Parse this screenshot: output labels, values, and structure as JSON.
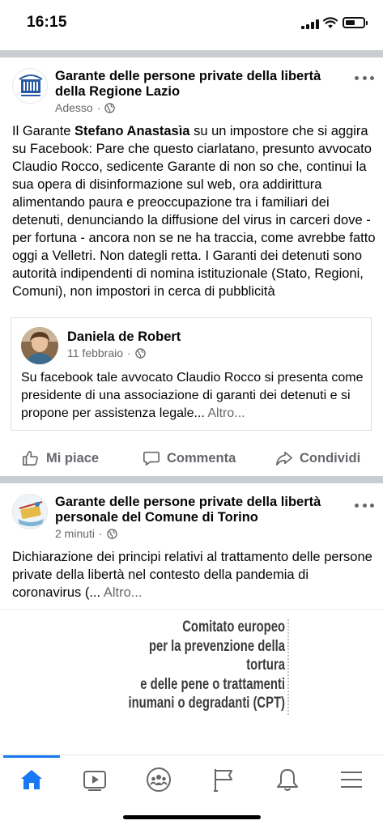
{
  "status_bar": {
    "time": "16:15",
    "battery_level": 0.55,
    "icons": [
      "signal-icon",
      "wifi-icon",
      "battery-icon"
    ]
  },
  "posts": [
    {
      "author": "Garante delle persone private della libertà della Regione Lazio",
      "time": "Adesso",
      "audience_icon": "globe-icon",
      "text_parts": [
        "Il Garante ",
        "Stefano Anastasìa",
        " su un impostore che si aggira su Facebook: Pare che questo ciarlatano, presunto avvocato Claudio Rocco, sedicente Garante di non so che, continui la sua opera di disinformazione sul web, ora addirittura alimentando paura e preoccupazione tra i familiari dei detenuti, denunciando la diffusione del virus in carceri dove - per fortuna - ancora non se ne ha traccia, come avrebbe fatto oggi a Velletri. Non dategli retta. I Garanti dei detenuti sono autorità indipendenti di nomina istituzionale (Stato, Regioni, Comuni), non impostori in cerca di pubblicità"
      ],
      "shared": {
        "author": "Daniela de Robert",
        "time": "11 febbraio",
        "text": "Su facebook tale avvocato Claudio Rocco si presenta come presidente di una associazione di garanti dei detenuti e si propone per assistenza legale...",
        "see_more": "Altro..."
      },
      "actions": {
        "like": "Mi piace",
        "comment": "Commenta",
        "share": "Condividi"
      }
    },
    {
      "author": "Garante delle persone private della libertà personale del Comune di Torino",
      "time": "2 minuti",
      "audience_icon": "globe-icon",
      "text": "Dichiarazione dei principi relativi al trattamento delle persone private della libertà nel contesto della pandemia di coronavirus (...",
      "see_more": "Altro...",
      "media_lines": [
        "Comitato europeo",
        "per la prevenzione della tortura",
        "e delle pene o trattamenti",
        "inumani o degradanti (CPT)"
      ]
    }
  ],
  "bottom_nav": {
    "items": [
      "home-icon",
      "watch-icon",
      "groups-icon",
      "pages-icon",
      "notifications-icon",
      "menu-icon"
    ],
    "active": "home-icon"
  },
  "colors": {
    "accent": "#1877f2",
    "secondary_text": "#65676b",
    "separator": "#c9ccd1"
  }
}
